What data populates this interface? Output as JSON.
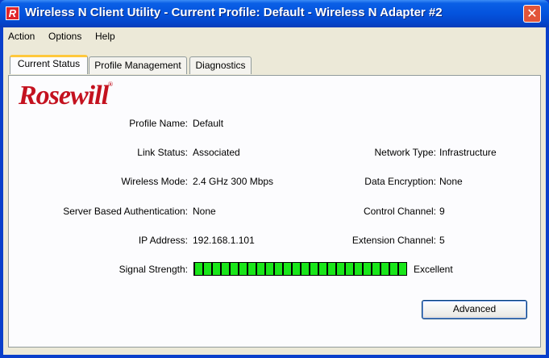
{
  "window": {
    "app_icon_letter": "R",
    "title": "Wireless N Client Utility - Current Profile: Default - Wireless N Adapter #2",
    "close_glyph": "✕"
  },
  "menu": [
    "Action",
    "Options",
    "Help"
  ],
  "tabs": [
    {
      "label": "Current Status",
      "active": true
    },
    {
      "label": "Profile Management",
      "active": false
    },
    {
      "label": "Diagnostics",
      "active": false
    }
  ],
  "logo": {
    "text": "Rosewill",
    "reg": "®",
    "color": "#c4121f"
  },
  "status": {
    "profile_name": {
      "label": "Profile Name:",
      "value": "Default"
    },
    "link_status": {
      "label": "Link Status:",
      "value": "Associated"
    },
    "wireless_mode": {
      "label": "Wireless Mode:",
      "value": "2.4 GHz 300 Mbps"
    },
    "server_auth": {
      "label": "Server Based Authentication:",
      "value": "None"
    },
    "ip_address": {
      "label": "IP Address:",
      "value": "192.168.1.101"
    },
    "signal_strength": {
      "label": "Signal Strength:",
      "value": "Excellent",
      "level": 1.0
    },
    "network_type": {
      "label": "Network Type:",
      "value": "Infrastructure"
    },
    "data_encryption": {
      "label": "Data Encryption:",
      "value": "None"
    },
    "control_channel": {
      "label": "Control Channel:",
      "value": "9"
    },
    "extension_channel": {
      "label": "Extension Channel:",
      "value": "5"
    }
  },
  "buttons": {
    "advanced": "Advanced"
  },
  "colors": {
    "title_bar": "#0453dd",
    "signal_green": "#19e619",
    "logo_red": "#c4121f"
  }
}
